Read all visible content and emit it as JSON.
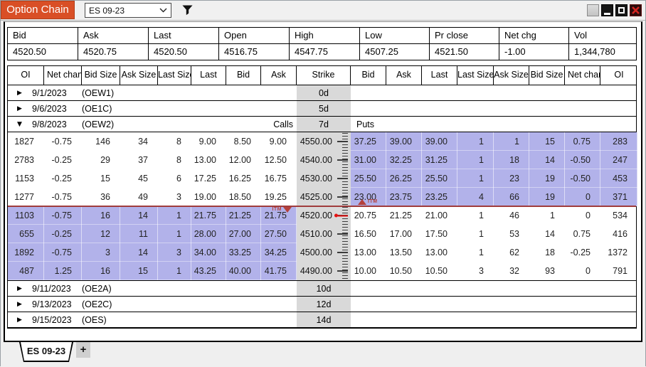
{
  "colors": {
    "accent": "#d94f26",
    "accent-border": "#b23d17",
    "hl": "#b2b2ea",
    "strike-bg": "#d9d9d9",
    "atm-line": "#a03c3c",
    "pointer": "#e51212",
    "itm": "#b5413c",
    "close-red": "#c11b17"
  },
  "window": {
    "title": "Option Chain",
    "symbol": "ES 09-23"
  },
  "summary": {
    "columns": [
      "Bid",
      "Ask",
      "Last",
      "Open",
      "High",
      "Low",
      "Pr close",
      "Net chg",
      "Vol"
    ],
    "values": [
      "4520.50",
      "4520.75",
      "4520.50",
      "4516.75",
      "4547.75",
      "4507.25",
      "4521.50",
      "-1.00",
      "1,344,780"
    ]
  },
  "chain": {
    "headers": [
      "OI",
      "Net chang",
      "Bid Size",
      "Ask Size",
      "Last Size",
      "Last",
      "Bid",
      "Ask",
      "Strike",
      "Bid",
      "Ask",
      "Last",
      "Last Size",
      "Ask Size",
      "Bid Size",
      "Net chang",
      "OI"
    ],
    "itm_label": "ITM",
    "expirations_top": [
      {
        "date": "9/1/2023",
        "code": "(OEW1)",
        "dte": "0d",
        "expanded": false
      },
      {
        "date": "9/6/2023",
        "code": "(OE1C)",
        "dte": "5d",
        "expanded": false
      },
      {
        "date": "9/8/2023",
        "code": "(OEW2)",
        "dte": "7d",
        "expanded": true,
        "calls_label": "Calls",
        "puts_label": "Puts"
      }
    ],
    "rows": [
      {
        "strike": "4550.00",
        "call": [
          "1827",
          "-0.75",
          "146",
          "34",
          "8",
          "9.00",
          "8.50",
          "9.00"
        ],
        "put": [
          "37.25",
          "39.00",
          "39.00",
          "1",
          "1",
          "15",
          "0.75",
          "283"
        ],
        "call_itm": false,
        "put_itm": true,
        "atm": false
      },
      {
        "strike": "4540.00",
        "call": [
          "2783",
          "-0.25",
          "29",
          "37",
          "8",
          "13.00",
          "12.00",
          "12.50"
        ],
        "put": [
          "31.00",
          "32.25",
          "31.25",
          "1",
          "18",
          "14",
          "-0.50",
          "247"
        ],
        "call_itm": false,
        "put_itm": true,
        "atm": false
      },
      {
        "strike": "4530.00",
        "call": [
          "1153",
          "-0.25",
          "15",
          "45",
          "6",
          "17.25",
          "16.25",
          "16.75"
        ],
        "put": [
          "25.50",
          "26.25",
          "25.50",
          "1",
          "23",
          "19",
          "-0.50",
          "453"
        ],
        "call_itm": false,
        "put_itm": true,
        "atm": false
      },
      {
        "strike": "4525.00",
        "call": [
          "1277",
          "-0.75",
          "36",
          "49",
          "3",
          "19.00",
          "18.50",
          "19.25"
        ],
        "put": [
          "23.00",
          "23.75",
          "23.25",
          "4",
          "66",
          "19",
          "0",
          "371"
        ],
        "call_itm": false,
        "put_itm": true,
        "atm": false
      },
      {
        "strike": "4520.00",
        "call": [
          "1103",
          "-0.75",
          "16",
          "14",
          "1",
          "21.75",
          "21.25",
          "21.75"
        ],
        "put": [
          "20.75",
          "21.25",
          "21.00",
          "1",
          "46",
          "1",
          "0",
          "534"
        ],
        "call_itm": true,
        "put_itm": false,
        "atm": true
      },
      {
        "strike": "4510.00",
        "call": [
          "655",
          "-0.25",
          "12",
          "11",
          "1",
          "28.00",
          "27.00",
          "27.50"
        ],
        "put": [
          "16.50",
          "17.00",
          "17.50",
          "1",
          "53",
          "14",
          "0.75",
          "416"
        ],
        "call_itm": true,
        "put_itm": false,
        "atm": false
      },
      {
        "strike": "4500.00",
        "call": [
          "1892",
          "-0.75",
          "3",
          "14",
          "3",
          "34.00",
          "33.25",
          "34.25"
        ],
        "put": [
          "13.00",
          "13.50",
          "13.00",
          "1",
          "62",
          "18",
          "-0.25",
          "1372"
        ],
        "call_itm": true,
        "put_itm": false,
        "atm": false
      },
      {
        "strike": "4490.00",
        "call": [
          "487",
          "1.25",
          "16",
          "15",
          "1",
          "43.25",
          "40.00",
          "41.75"
        ],
        "put": [
          "10.00",
          "10.50",
          "10.50",
          "3",
          "32",
          "93",
          "0",
          "791"
        ],
        "call_itm": true,
        "put_itm": false,
        "atm": false
      }
    ],
    "expirations_bottom": [
      {
        "date": "9/11/2023",
        "code": "(OE2A)",
        "dte": "10d",
        "expanded": false
      },
      {
        "date": "9/13/2023",
        "code": "(OE2C)",
        "dte": "12d",
        "expanded": false
      },
      {
        "date": "9/15/2023",
        "code": "(OES)",
        "dte": "14d",
        "expanded": false
      }
    ]
  },
  "footer": {
    "active_tab": "ES 09-23",
    "add_tab": "+"
  }
}
